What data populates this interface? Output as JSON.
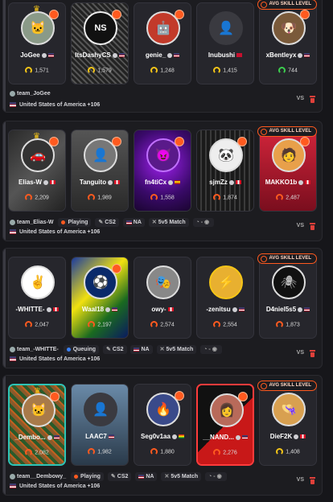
{
  "teams": [
    {
      "team_name": "team_JoGee",
      "status": "",
      "game": "",
      "region_chip": "",
      "mode": "",
      "region": "United States of America +106",
      "avg_tag": "AVG SKILL LEVEL",
      "vs": "VS",
      "players": [
        {
          "name": "JoGee",
          "elo": "1,571"
        },
        {
          "name": "ItsDashyCS",
          "elo": "1,579"
        },
        {
          "name": "genie_",
          "elo": "1,248"
        },
        {
          "name": "Inubushi",
          "elo": "1,415"
        },
        {
          "name": "xBentleyx",
          "elo": "744"
        }
      ]
    },
    {
      "team_name": "team_Elias-W",
      "status": "Playing",
      "game": "CS2",
      "region_chip": "NA",
      "mode": "5v5 Match",
      "region": "United States of America +106",
      "avg_tag": "AVG SKILL LEVEL",
      "vs": "VS",
      "players": [
        {
          "name": "Elias-W",
          "elo": "2,209"
        },
        {
          "name": "Tanguito",
          "elo": "1,989"
        },
        {
          "name": "fn4tiCx",
          "elo": "1,558"
        },
        {
          "name": "sjmZz",
          "elo": "1,874"
        },
        {
          "name": "MAKKO1b",
          "elo": "2,487"
        }
      ]
    },
    {
      "team_name": "team_-WHITTE-",
      "status": "Queuing",
      "game": "CS2",
      "region_chip": "NA",
      "mode": "5v5 Match",
      "region": "United States of America +106",
      "avg_tag": "AVG SKILL LEVEL",
      "vs": "VS",
      "players": [
        {
          "name": "-WHITTE-",
          "elo": "2,047"
        },
        {
          "name": "Waal18",
          "elo": "2,197"
        },
        {
          "name": "owy-",
          "elo": "2,574"
        },
        {
          "name": "-zenitsu",
          "elo": "2,554"
        },
        {
          "name": "D4niel5s5",
          "elo": "1,873"
        }
      ]
    },
    {
      "team_name": "team__Dembowy_",
      "status": "Playing",
      "game": "CS2",
      "region_chip": "NA",
      "mode": "5v5 Match",
      "region": "United States of America +106",
      "avg_tag": "AVG SKILL LEVEL",
      "vs": "VS",
      "players": [
        {
          "name": "_Dembo...",
          "elo": "2,082"
        },
        {
          "name": "LAAC7",
          "elo": "1,982"
        },
        {
          "name": "Seg0v1aa",
          "elo": "1,880"
        },
        {
          "name": "__NAND...",
          "elo": "2,276"
        },
        {
          "name": "DieF2K",
          "elo": "1,408"
        }
      ]
    }
  ]
}
